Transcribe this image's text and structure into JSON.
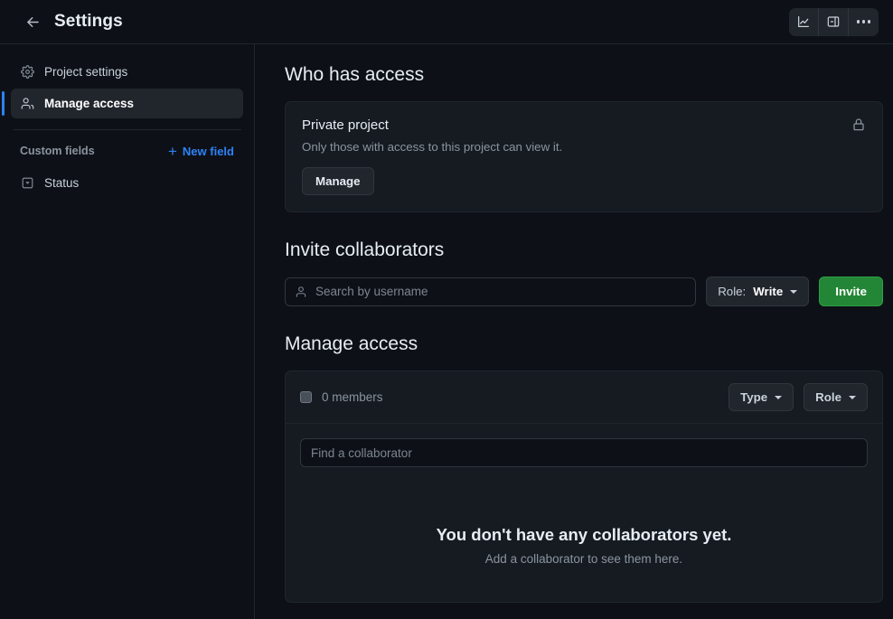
{
  "header": {
    "back_icon": "arrow-left-icon",
    "title": "Settings",
    "actions": [
      {
        "name": "insights-button",
        "icon": "line-chart-icon"
      },
      {
        "name": "toggle-panel-button",
        "icon": "side-panel-icon"
      },
      {
        "name": "more-options-button",
        "icon": "three-dots-icon"
      }
    ]
  },
  "sidebar": {
    "items": [
      {
        "label": "Project settings",
        "icon": "gear-icon",
        "selected": false
      },
      {
        "label": "Manage access",
        "icon": "people-icon",
        "selected": true
      }
    ],
    "custom_fields": {
      "label": "Custom fields",
      "new_field_label": "New field",
      "new_field_icon": "plus-icon",
      "fields": [
        {
          "label": "Status",
          "icon": "single-select-icon"
        }
      ]
    }
  },
  "main": {
    "who_has_access": {
      "title": "Who has access",
      "visibility_heading": "Private project",
      "visibility_description": "Only those with access to this project can view it.",
      "lock_icon": "lock-icon",
      "manage_button": "Manage"
    },
    "invite": {
      "title": "Invite collaborators",
      "search_placeholder": "Search by username",
      "search_icon": "person-icon",
      "role_prefix": "Role:",
      "role_value": "Write",
      "invite_button": "Invite"
    },
    "manage_access": {
      "title": "Manage access",
      "members_count": "0 members",
      "filters": [
        {
          "label": "Type"
        },
        {
          "label": "Role"
        }
      ],
      "find_placeholder": "Find a collaborator",
      "empty_title": "You don't have any collaborators yet.",
      "empty_subtitle": "Add a collaborator to see them here."
    }
  },
  "colors": {
    "page_bg": "#0d1117",
    "card_bg": "#161b22",
    "border": "#21262d",
    "accent_blue": "#2f81f7",
    "accent_green": "#238636",
    "text": "#e6edf3",
    "muted": "#8b949e"
  }
}
